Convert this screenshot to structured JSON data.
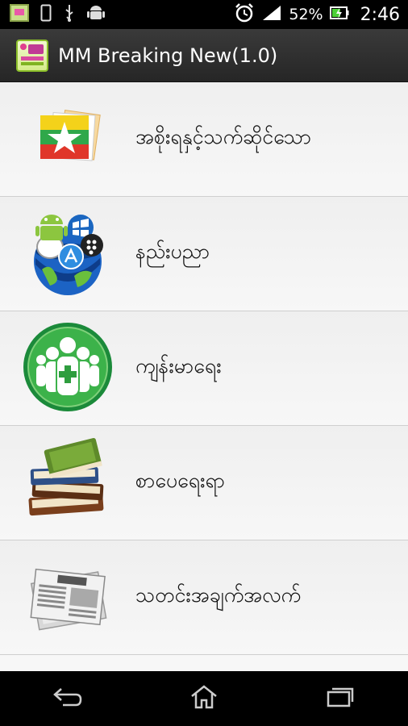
{
  "status_bar": {
    "battery_percent": "52%",
    "time": "2:46",
    "icons": [
      "app-thumbnail-icon",
      "phone-icon",
      "usb-icon",
      "android-icon",
      "alarm-icon",
      "signal-icon",
      "battery-charging-icon"
    ]
  },
  "action_bar": {
    "title": "MM Breaking New(1.0)",
    "app_icon": "mm-breaking-news-logo-icon"
  },
  "list": {
    "items": [
      {
        "label": "အစိုးရနှင့်သက်ဆိုင်သော",
        "icon": "myanmar-flag-icon"
      },
      {
        "label": "နည်းပညာ",
        "icon": "technology-globe-icon"
      },
      {
        "label": "ကျန်းမာရေး",
        "icon": "health-people-icon"
      },
      {
        "label": "စာပေရေးရာ",
        "icon": "books-icon"
      },
      {
        "label": "သတင်းအချက်အလက်",
        "icon": "newspaper-icon"
      }
    ]
  },
  "nav_bar": {
    "buttons": [
      "back-icon",
      "home-icon",
      "recent-apps-icon"
    ]
  },
  "colors": {
    "action_bar": "#2f2f2f",
    "list_bg": "#f2f2f2",
    "divider": "#cfcfcf"
  }
}
